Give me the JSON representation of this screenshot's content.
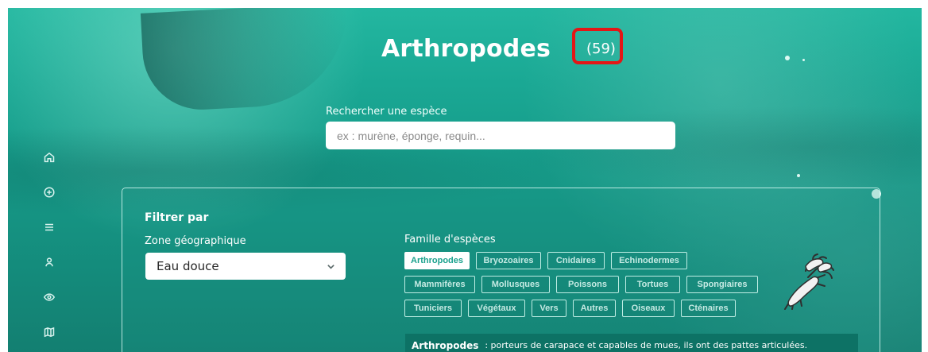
{
  "header": {
    "title": "Arthropodes",
    "count": "(59)"
  },
  "search": {
    "label": "Rechercher une espèce",
    "placeholder": "ex : murène, éponge, requin..."
  },
  "filters": {
    "title": "Filtrer par",
    "zone": {
      "label": "Zone géographique",
      "selected": "Eau douce"
    },
    "family": {
      "label": "Famille d'espèces",
      "chips": [
        "Arthropodes",
        "Bryozoaires",
        "Cnidaires",
        "Echinodermes",
        "Mammifères",
        "Mollusques",
        "Poissons",
        "Tortues",
        "Spongiaires",
        "Tuniciers",
        "Végétaux",
        "Vers",
        "Autres",
        "Oiseaux",
        "Cténaires"
      ],
      "active": "Arthropodes",
      "description": {
        "name": "Arthropodes",
        "text": ": porteurs de carapace et capables de mues, ils ont des pattes articulées."
      }
    }
  },
  "sidebar": {
    "items": [
      {
        "icon": "home-icon"
      },
      {
        "icon": "plus-circle-icon"
      },
      {
        "icon": "list-icon"
      },
      {
        "icon": "user-icon"
      },
      {
        "icon": "eye-icon"
      },
      {
        "icon": "map-icon"
      }
    ]
  },
  "colors": {
    "accent": "#1aa18d",
    "highlight": "#e41616"
  }
}
